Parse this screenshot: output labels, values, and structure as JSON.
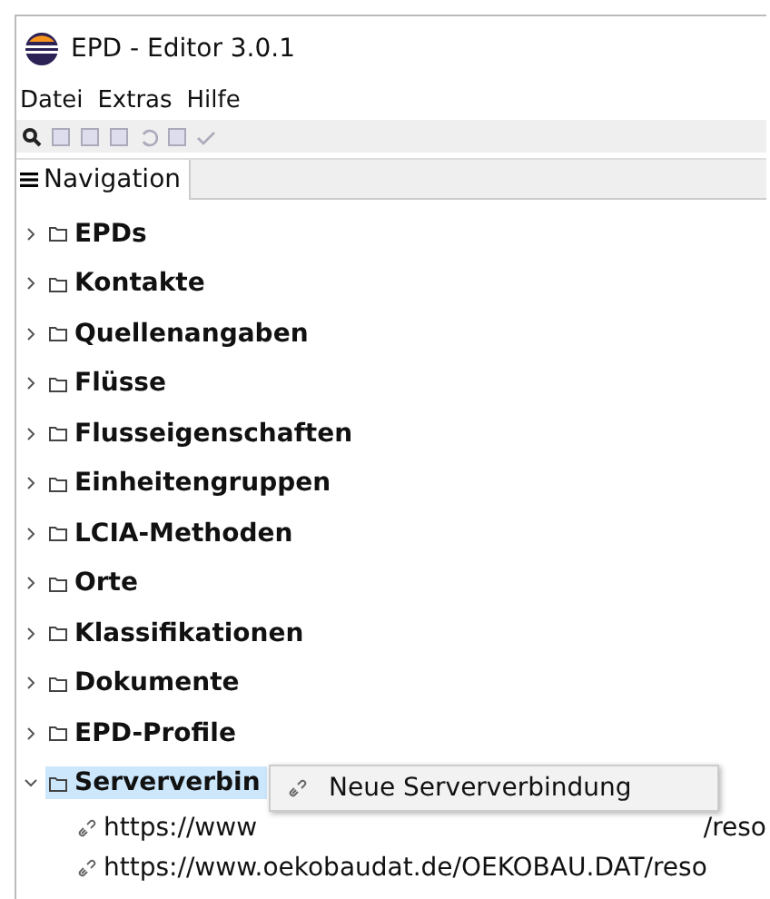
{
  "window": {
    "title": "EPD - Editor 3.0.1"
  },
  "menu": [
    "Datei",
    "Extras",
    "Hilfe"
  ],
  "tabs": [
    {
      "label": "Navigation",
      "selected": true
    }
  ],
  "tree": [
    {
      "label": "EPDs",
      "expanded": false,
      "selected": false
    },
    {
      "label": "Kontakte",
      "expanded": false,
      "selected": false
    },
    {
      "label": "Quellenangaben",
      "expanded": false,
      "selected": false
    },
    {
      "label": "Flüsse",
      "expanded": false,
      "selected": false
    },
    {
      "label": "Flusseigenschaften",
      "expanded": false,
      "selected": false
    },
    {
      "label": "Einheitengruppen",
      "expanded": false,
      "selected": false
    },
    {
      "label": "LCIA-Methoden",
      "expanded": false,
      "selected": false
    },
    {
      "label": "Orte",
      "expanded": false,
      "selected": false
    },
    {
      "label": "Klassifikationen",
      "expanded": false,
      "selected": false
    },
    {
      "label": "Dokumente",
      "expanded": false,
      "selected": false
    },
    {
      "label": "EPD-Profile",
      "expanded": false,
      "selected": false
    },
    {
      "label": "Serververbin",
      "expanded": true,
      "selected": true,
      "children": [
        {
          "label": "https://www",
          "tail": "/reso"
        },
        {
          "label": "https://www.oekobaudat.de/OEKOBAU.DAT/reso"
        }
      ]
    }
  ],
  "context_menu": {
    "items": [
      "Neue Serververbindung"
    ]
  }
}
